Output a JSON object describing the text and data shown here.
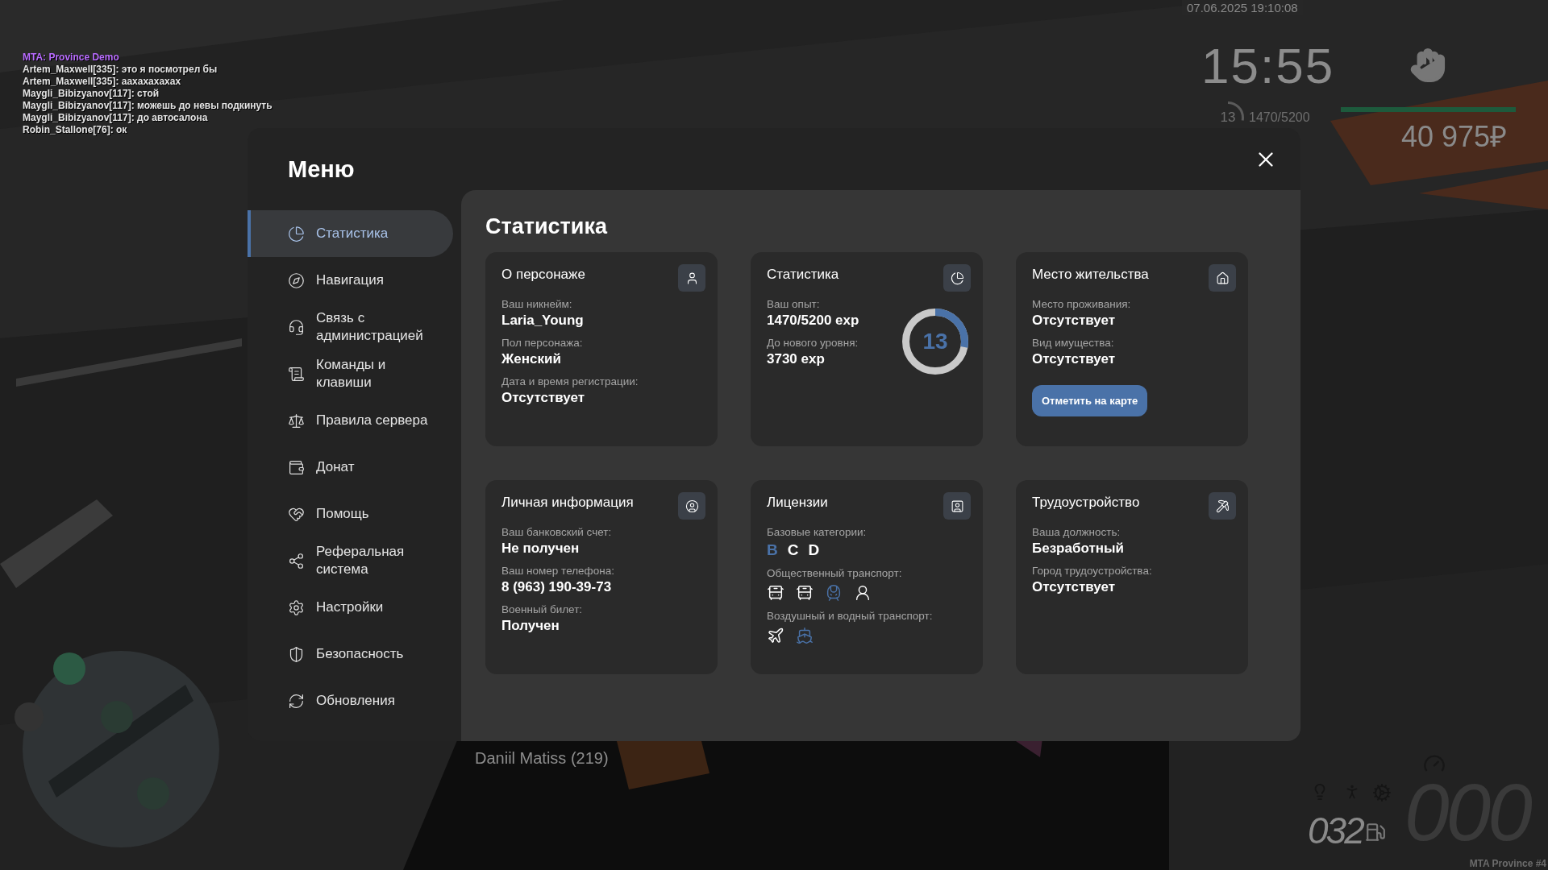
{
  "chat": [
    {
      "kind": "system",
      "text": "MTA: Province Demo"
    },
    {
      "kind": "player",
      "text": "Artem_Maxwell[335]: это я посмотрел бы"
    },
    {
      "kind": "player",
      "text": "Artem_Maxwell[335]: аахахахахах"
    },
    {
      "kind": "player",
      "text": "Maygli_Bibizyanov[117]: стой"
    },
    {
      "kind": "player",
      "text": "Maygli_Bibizyanov[117]: можешь до невы подкинуть"
    },
    {
      "kind": "player",
      "text": "Maygli_Bibizyanov[117]: до автосалона"
    },
    {
      "kind": "player",
      "text": "Robin_Stallone[76]: ок"
    }
  ],
  "hud": {
    "datetime": "07.06.2025 19:10:08",
    "clock": "15:55",
    "player_level": "13",
    "experience": "1470/5200",
    "experience_bar": {
      "level": 0.28
    },
    "health_bar": {
      "level": 1
    },
    "money": "40 975₽"
  },
  "nametag": "Daniil Matiss (219)",
  "speedometer": {
    "speed": "000",
    "fuel": "032"
  },
  "server_label": "MTA Province #4",
  "menu": {
    "title": "Меню",
    "sidebar": [
      {
        "label": "Статистика",
        "selected": true
      },
      {
        "label": "Навигация",
        "selected": false
      },
      {
        "label": "Связь с администрацией",
        "selected": false
      },
      {
        "label": "Команды и клавиши",
        "selected": false
      },
      {
        "label": "Правила сервера",
        "selected": false
      },
      {
        "label": "Донат",
        "selected": false
      },
      {
        "label": "Помощь",
        "selected": false
      },
      {
        "label": "Реферальная система",
        "selected": false
      },
      {
        "label": "Настройки",
        "selected": false
      },
      {
        "label": "Безопасность",
        "selected": false
      },
      {
        "label": "Обновления",
        "selected": false
      }
    ],
    "section_title": "Статистика",
    "cards": [
      {
        "kind": "fields",
        "title": "О персонаже",
        "fields": [
          {
            "label": "Ваш никнейм:",
            "value": "Laria_Young"
          },
          {
            "label": "Пол персонажа:",
            "value": "Женский"
          },
          {
            "label": "Дата и время регистрации:",
            "value": "Отсутствует"
          }
        ]
      },
      {
        "kind": "stats",
        "title": "Статистика",
        "fields": [
          {
            "label": "Ваш опыт:",
            "value": "1470/5200 exp"
          },
          {
            "label": "До нового уровня:",
            "value": "3730 exp"
          }
        ],
        "ring": {
          "text": "13",
          "level": 0.28
        }
      },
      {
        "kind": "fields",
        "title": "Место жительства",
        "fields": [
          {
            "label": "Место проживания:",
            "value": "Отсутствует"
          },
          {
            "label": "Вид имущества:",
            "value": "Отсутствует"
          }
        ],
        "button": "Отметить на карте"
      },
      {
        "kind": "fields",
        "title": "Личная информация",
        "fields": [
          {
            "label": "Ваш банковский счет:",
            "value": "Не получен"
          },
          {
            "label": "Ваш номер телефона:",
            "value": "8 (963) 190-39-73"
          },
          {
            "label": "Военный билет:",
            "value": "Получен"
          }
        ]
      },
      {
        "kind": "licenses",
        "title": "Лицензии",
        "groups": [
          {
            "kind": "letters",
            "label": "Базовые категории:",
            "items": [
              {
                "text": "B",
                "active": true
              },
              {
                "text": "C",
                "active": false
              },
              {
                "text": "D",
                "active": false
              }
            ]
          },
          {
            "kind": "icons",
            "label": "Общественный транспорт:",
            "items": [
              {
                "active": false
              },
              {
                "active": false
              },
              {
                "active": true
              },
              {
                "active": false
              }
            ]
          },
          {
            "kind": "icons",
            "label": "Воздушный и водный транспорт:",
            "items": [
              {
                "active": false
              },
              {
                "active": true
              }
            ]
          }
        ]
      },
      {
        "kind": "fields",
        "title": "Трудоустройство",
        "fields": [
          {
            "label": "Ваша должность:",
            "value": "Безработный"
          },
          {
            "label": "Город трудоустройства:",
            "value": "Отсутствует"
          }
        ]
      }
    ]
  }
}
